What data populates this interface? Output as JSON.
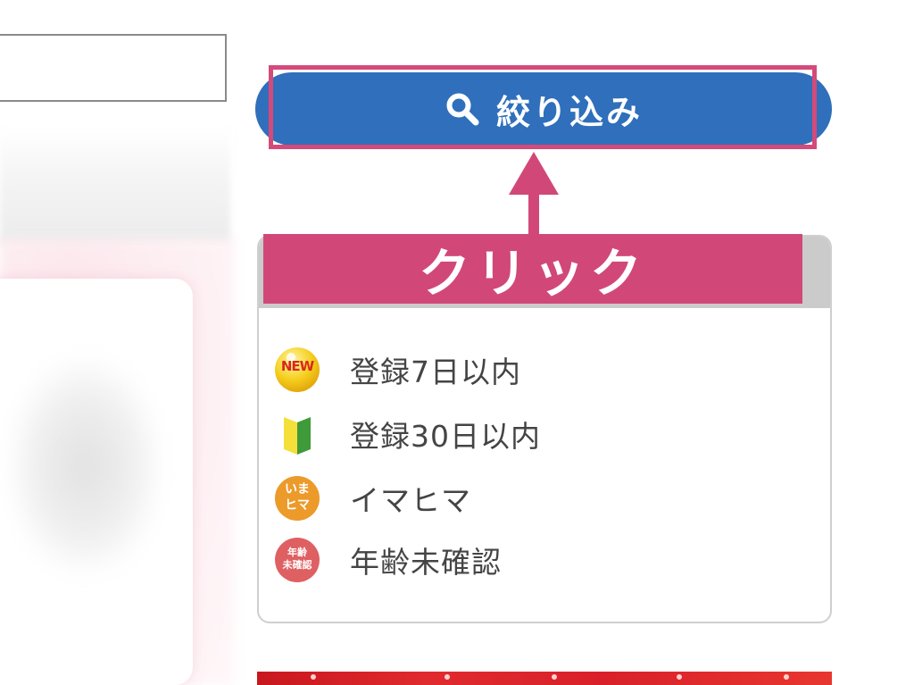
{
  "filter_button": {
    "label": "絞り込み",
    "icon": "search-icon",
    "color": "#2f6fbb"
  },
  "annotation": {
    "click_label": "クリック",
    "highlight_color": "#d44a7a"
  },
  "legend": {
    "items": [
      {
        "icon": "new-badge-icon",
        "badge_text": "NEW",
        "label": "登録7日以内"
      },
      {
        "icon": "beginner-mark-icon",
        "label": "登録30日以内"
      },
      {
        "icon": "imahima-badge-icon",
        "badge_line1": "いま",
        "badge_line2": "ヒマ",
        "label": "イマヒマ"
      },
      {
        "icon": "age-unverified-badge-icon",
        "badge_line1": "年齢",
        "badge_line2": "未確認",
        "label": "年齢未確認"
      }
    ]
  }
}
